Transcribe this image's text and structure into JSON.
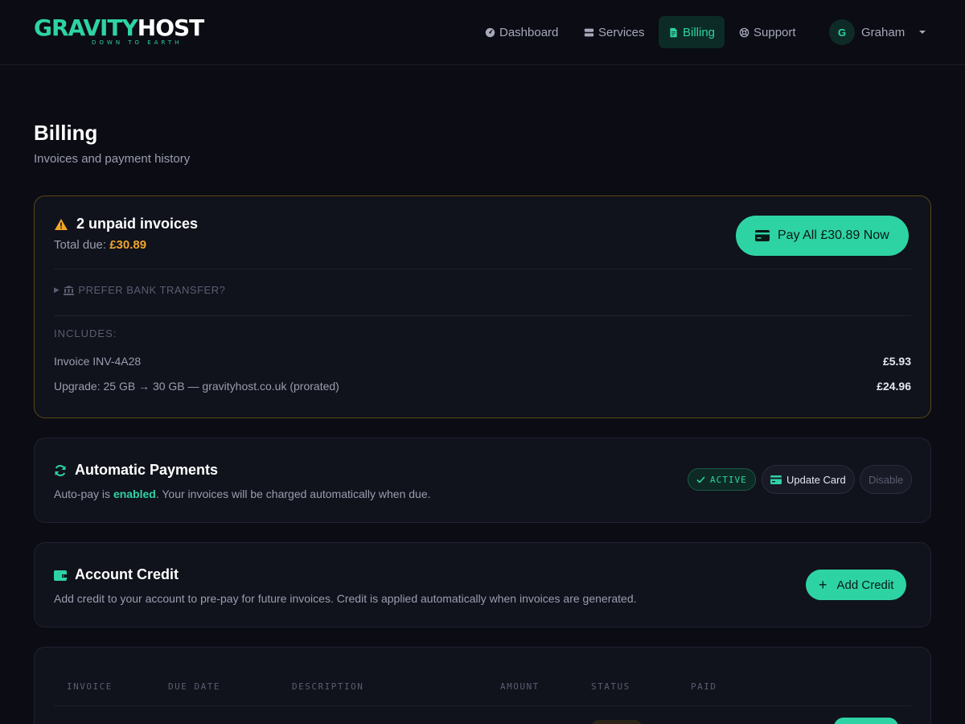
{
  "brand": {
    "name_part1": "GRAVITY",
    "name_part2": "HOST",
    "tagline": "DOWN TO EARTH"
  },
  "nav": {
    "items": [
      {
        "label": "Dashboard",
        "icon": "gauge-icon",
        "active": false
      },
      {
        "label": "Services",
        "icon": "server-icon",
        "active": false
      },
      {
        "label": "Billing",
        "icon": "document-icon",
        "active": true
      },
      {
        "label": "Support",
        "icon": "lifebuoy-icon",
        "active": false
      }
    ],
    "user": {
      "initial": "G",
      "name": "Graham"
    }
  },
  "page": {
    "title": "Billing",
    "subtitle": "Invoices and payment history"
  },
  "unpaid": {
    "title": "2 unpaid invoices",
    "total_label": "Total due:",
    "total_amount": "£30.89",
    "pay_button": "Pay All £30.89 Now",
    "bank_toggle": "PREFER BANK TRANSFER?",
    "includes_label": "INCLUDES:",
    "items": [
      {
        "description": "Invoice INV-4A28",
        "amount": "£5.93"
      },
      {
        "description": "Upgrade: 25 GB → 30 GB — gravityhost.co.uk (prorated)",
        "amount": "£24.96"
      }
    ],
    "accent_color": "#f0a52a"
  },
  "autopay": {
    "title": "Automatic Payments",
    "desc_prefix": "Auto-pay is ",
    "desc_state": "enabled",
    "desc_suffix": ". Your invoices will be charged automatically when due.",
    "badge": "ACTIVE",
    "update_button": "Update Card",
    "disable_button": "Disable"
  },
  "credit": {
    "title": "Account Credit",
    "description": "Add credit to your account to pre-pay for future invoices. Credit is applied automatically when invoices are generated.",
    "add_button": "Add Credit"
  },
  "invoices_table": {
    "columns": [
      "INVOICE",
      "DUE DATE",
      "DESCRIPTION",
      "AMOUNT",
      "STATUS",
      "PAID"
    ]
  },
  "colors": {
    "accent": "#2ed3a4",
    "warning": "#f0a52a",
    "background": "#0b0c14",
    "card": "#10121c"
  }
}
